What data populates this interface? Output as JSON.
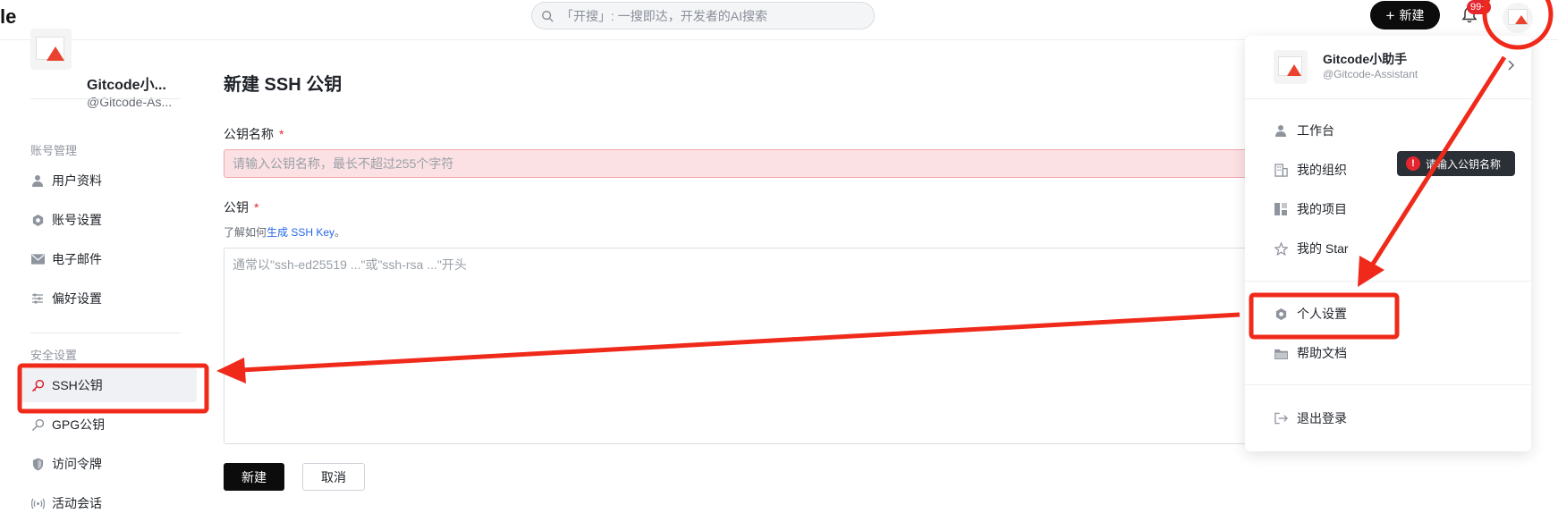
{
  "topbar": {
    "logo_fragment": "le",
    "search_placeholder": "「开搜」: 一搜即达，开发者的AI搜索",
    "new_button": "新建",
    "notification_badge": "99+"
  },
  "sidebar": {
    "profile": {
      "name": "Gitcode小...",
      "handle": "@Gitcode-As..."
    },
    "sections": [
      {
        "title": "账号管理",
        "items": [
          "用户资料",
          "账号设置",
          "电子邮件",
          "偏好设置"
        ]
      },
      {
        "title": "安全设置",
        "items": [
          "SSH公钥",
          "GPG公钥",
          "访问令牌",
          "活动会话"
        ]
      }
    ],
    "active_item": "SSH公钥"
  },
  "form": {
    "title": "新建 SSH 公钥",
    "name_label": "公钥名称",
    "required_mark": "*",
    "name_placeholder": "请输入公钥名称，最长不超过255个字符",
    "key_label": "公钥",
    "help_prefix": "了解如何",
    "help_link": "生成 SSH Key",
    "help_suffix": "。",
    "key_placeholder": "通常以\"ssh-ed25519 ...\"或\"ssh-rsa ...\"开头",
    "create_button": "新建",
    "cancel_button": "取消"
  },
  "dropdown": {
    "user_name": "Gitcode小助手",
    "user_handle": "@Gitcode-Assistant",
    "items": [
      "工作台",
      "我的组织",
      "我的项目",
      "我的 Star",
      "个人设置",
      "帮助文档",
      "退出登录"
    ]
  },
  "tooltip": {
    "text": "请输入公钥名称"
  },
  "colors": {
    "accent_dark": "#0c0c0c",
    "error_red": "#e5262e",
    "annotation_red": "#f02a1b",
    "link_blue": "#2667e8",
    "input_error_bg": "#fbe1e3"
  }
}
